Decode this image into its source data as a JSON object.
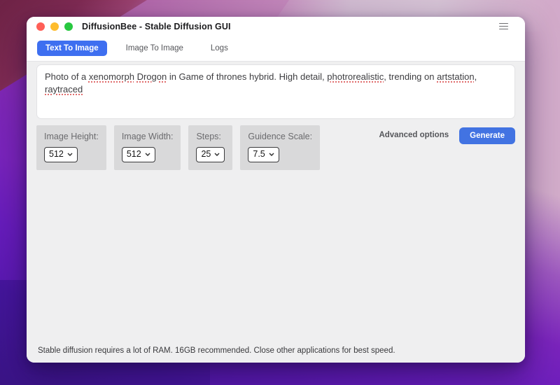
{
  "window": {
    "title": "DiffusionBee - Stable Diffusion GUI",
    "traffic_lights": [
      "close",
      "minimize",
      "zoom"
    ],
    "menu_icon": "hamburger"
  },
  "tabs": {
    "items": [
      {
        "label": "Text To Image",
        "active": true
      },
      {
        "label": "Image To Image",
        "active": false
      },
      {
        "label": "Logs",
        "active": false
      }
    ]
  },
  "prompt": {
    "segments": [
      {
        "text": "Photo of a ",
        "misspelled": false
      },
      {
        "text": "xenomorph",
        "misspelled": true
      },
      {
        "text": " ",
        "misspelled": false
      },
      {
        "text": "Drogon",
        "misspelled": true
      },
      {
        "text": " in Game of thrones hybrid. High detail, ",
        "misspelled": false
      },
      {
        "text": "photrorealistic",
        "misspelled": true
      },
      {
        "text": ", trending on ",
        "misspelled": false
      },
      {
        "text": "artstation",
        "misspelled": true
      },
      {
        "text": ", ",
        "misspelled": false
      },
      {
        "text": "raytraced",
        "misspelled": true
      }
    ]
  },
  "controls": {
    "items": [
      {
        "label": "Image Height:",
        "value": "512"
      },
      {
        "label": "Image Width:",
        "value": "512"
      },
      {
        "label": "Steps:",
        "value": "25"
      },
      {
        "label": "Guidence Scale:",
        "value": "7.5"
      }
    ],
    "advanced_options_label": "Advanced options",
    "generate_label": "Generate"
  },
  "footer": {
    "note": "Stable diffusion requires a lot of RAM. 16GB recommended. Close other applications for best speed."
  },
  "colors": {
    "active_tab_blue": "#3e6ff0",
    "generate_blue": "#4273e2",
    "misspelled_red": "#e06d6d",
    "content_gray": "#efeff0",
    "control_box_gray": "#d9d9da",
    "traffic_red": "#ff5f57",
    "traffic_yellow": "#febc2e",
    "traffic_green": "#28c840"
  }
}
